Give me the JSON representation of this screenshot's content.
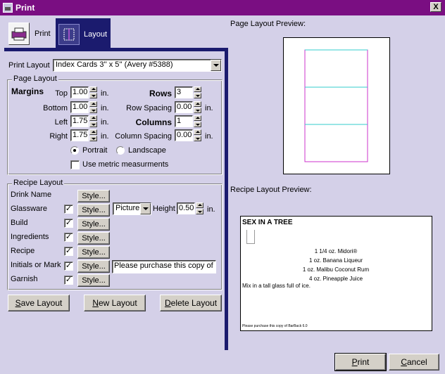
{
  "window": {
    "title": "Print",
    "close_label": "X"
  },
  "tabs": {
    "print_label": "Print",
    "layout_label": "Layout"
  },
  "print_layout": {
    "label": "Print Layout",
    "selected": "Index Cards 3'' x 5'' (Avery #5388)"
  },
  "page_layout": {
    "group_label": "Page Layout",
    "margins_label": "Margins",
    "top_label": "Top",
    "top_value": "1.00",
    "bottom_label": "Bottom",
    "bottom_value": "1.00",
    "left_label": "Left",
    "left_value": "1.75",
    "right_label": "Right",
    "right_value": "1.75",
    "unit": "in.",
    "rows_label": "Rows",
    "rows_value": "3",
    "row_spacing_label": "Row Spacing",
    "row_spacing_value": "0.00",
    "columns_label": "Columns",
    "columns_value": "1",
    "column_spacing_label": "Column Spacing",
    "column_spacing_value": "0.00",
    "portrait_label": "Portrait",
    "landscape_label": "Landscape",
    "metric_label": "Use metric measurments"
  },
  "recipe_layout": {
    "group_label": "Recipe Layout",
    "style_label": "Style...",
    "drink_name_label": "Drink Name",
    "glassware_label": "Glassware",
    "build_label": "Build",
    "ingredients_label": "Ingredients",
    "recipe_label": "Recipe",
    "initials_label": "Initials or Mark",
    "garnish_label": "Garnish",
    "check_mark": "✓",
    "glass_type": "Picture",
    "height_label": "Height",
    "height_value": "0.50",
    "unit": "in.",
    "initials_value": "Please purchase this copy of"
  },
  "actions": {
    "save_layout_pre": "",
    "save_layout_u": "S",
    "save_layout_post": "ave Layout",
    "new_layout_pre": "",
    "new_layout_u": "N",
    "new_layout_post": "ew Layout",
    "delete_layout_pre": "",
    "delete_layout_u": "D",
    "delete_layout_post": "elete Layout"
  },
  "preview": {
    "page_layout_label": "Page Layout Preview:",
    "recipe_layout_label": "Recipe Layout Preview:",
    "drink_name": "SEX IN A TREE",
    "ingredients": [
      "1 1/4 oz. Midori®",
      "1 oz. Banana Liqueur",
      "1 oz. Malibu Coconut Rum",
      "4 oz. Pineapple Juice"
    ],
    "recipe_text": "Mix in a tall glass full of ice.",
    "footer_text": "Please purchase this copy of BarBack 6.0"
  },
  "footer": {
    "print_pre": "",
    "print_u": "P",
    "print_post": "rint",
    "cancel_pre": "",
    "cancel_u": "C",
    "cancel_post": "ancel"
  },
  "colors": {
    "title_bar": "#7a0e82",
    "tab_selected": "#1b1b6e",
    "preview_border": "#cc33cc",
    "preview_rule": "#33cccc"
  }
}
